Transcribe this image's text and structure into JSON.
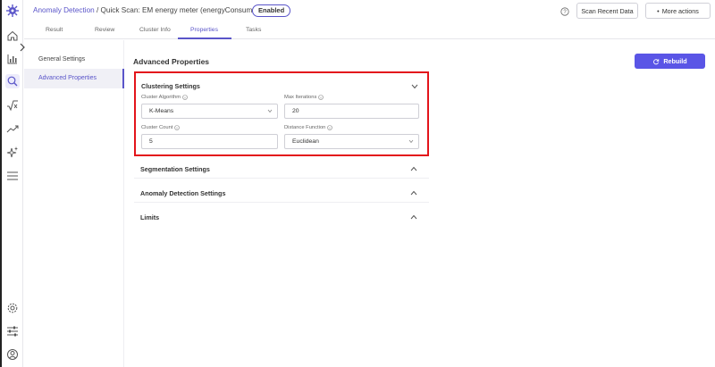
{
  "header": {
    "breadcrumb_link": "Anomaly Detection",
    "breadcrumb_rest": " / Quick Scan: EM energy meter (energyConsumption)",
    "status": "Enabled",
    "scan_label": "Scan Recent Data",
    "more_label": "More actions",
    "more_prefix": "•"
  },
  "tabs": [
    "Result",
    "Review",
    "Cluster Info",
    "Properties",
    "Tasks"
  ],
  "active_tab": "Properties",
  "side_nav": [
    {
      "label": "General Settings"
    },
    {
      "label": "Advanced Properties"
    }
  ],
  "content": {
    "title": "Advanced Properties",
    "rebuild_label": "Rebuild",
    "clustering": {
      "title": "Clustering Settings",
      "fields": {
        "algorithm_label": "Cluster Algorithm",
        "algorithm_value": "K-Means",
        "max_iter_label": "Max Iterations",
        "max_iter_value": "20",
        "count_label": "Cluster Count",
        "count_value": "5",
        "distance_label": "Distance Function",
        "distance_value": "Euclidean"
      }
    },
    "sections": [
      "Segmentation Settings",
      "Anomaly Detection Settings",
      "Limits"
    ]
  },
  "colors": {
    "accent": "#5a55c9",
    "button": "#5a55e6",
    "highlight": "#e3141b"
  },
  "icons": {
    "rail": [
      "logo-icon",
      "home-icon",
      "bar-chart-icon",
      "search-icon",
      "sqrt-icon",
      "trend-icon",
      "sparkle-icon",
      "menu-icon",
      "settings-icon",
      "sliders-icon",
      "user-icon"
    ]
  }
}
